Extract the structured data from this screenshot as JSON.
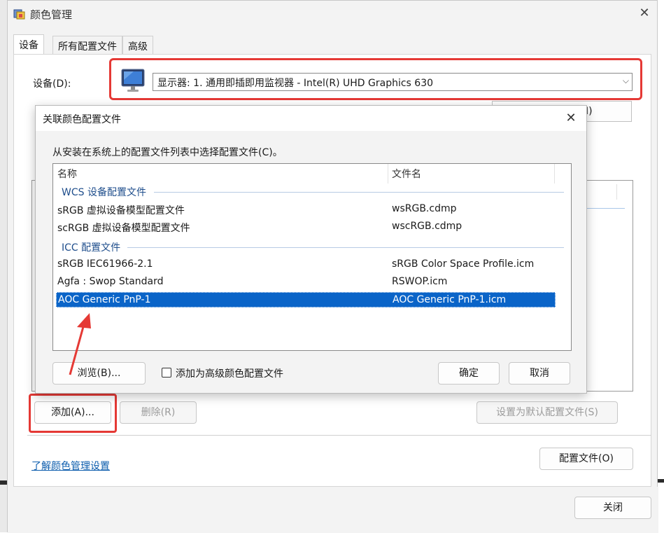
{
  "main_window": {
    "title": "颜色管理",
    "tabs": [
      "设备",
      "所有配置文件",
      "高级"
    ],
    "device_label": "设备(D):",
    "device_value": "显示器: 1. 通用即插即用监视器 - Intel(R) UHD Graphics 630",
    "hidden_button_fragment": "I)",
    "add_button": "添加(A)...",
    "delete_button": "删除(R)",
    "set_default_button": "设置为默认配置文件(S)",
    "learn_link": "了解颜色管理设置",
    "profiles_button": "配置文件(O)",
    "close_button": "关闭"
  },
  "dialog": {
    "title": "关联颜色配置文件",
    "instruction": "从安装在系统上的配置文件列表中选择配置文件(C)。",
    "columns": {
      "name": "名称",
      "filename": "文件名"
    },
    "groups": [
      {
        "label": "WCS 设备配置文件",
        "rows": [
          {
            "name": "sRGB 虚拟设备模型配置文件",
            "file": "wsRGB.cdmp"
          },
          {
            "name": "scRGB 虚拟设备模型配置文件",
            "file": "wscRGB.cdmp"
          }
        ]
      },
      {
        "label": "ICC 配置文件",
        "rows": [
          {
            "name": "sRGB IEC61966-2.1",
            "file": "sRGB Color Space Profile.icm"
          },
          {
            "name": "Agfa : Swop Standard",
            "file": "RSWOP.icm"
          },
          {
            "name": "AOC Generic PnP-1",
            "file": "AOC Generic PnP-1.icm"
          }
        ]
      }
    ],
    "browse_button": "浏览(B)...",
    "checkbox_label": "添加为高级颜色配置文件",
    "ok_button": "确定",
    "cancel_button": "取消"
  },
  "colors": {
    "accent": "#0a64c8",
    "annotation_red": "#e53935",
    "link": "#0b5cad"
  },
  "icons": {
    "app": "color-management-icon",
    "monitor": "monitor-icon",
    "close": "close-icon",
    "dropdown": "chevron-down-icon",
    "annotation": "red-arrow-icon"
  }
}
